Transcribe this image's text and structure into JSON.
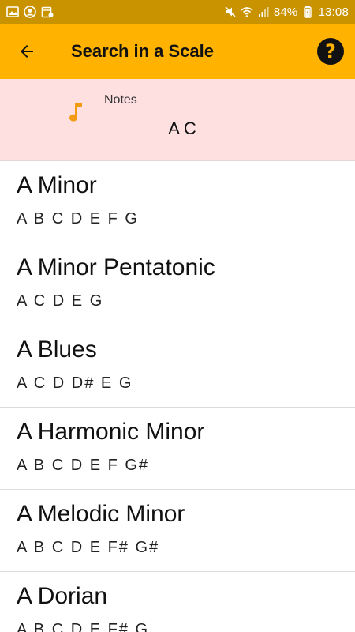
{
  "status_bar": {
    "battery": "84%",
    "time": "13:08",
    "icons": [
      "image-icon",
      "account-icon",
      "calendar-icon",
      "mute-icon",
      "wifi-icon",
      "signal-icon",
      "battery-icon"
    ]
  },
  "app_bar": {
    "title": "Search in a Scale",
    "back_icon": "arrow-left-icon",
    "help_icon": "help-circle-icon",
    "help_glyph": "?"
  },
  "notes": {
    "label": "Notes",
    "value": "A C",
    "icon": "music-note-icon"
  },
  "scales": [
    {
      "name": "A Minor",
      "notes": "A B C D E F G"
    },
    {
      "name": "A Minor Pentatonic",
      "notes": "A C D E G"
    },
    {
      "name": "A Blues",
      "notes": "A C D D# E G"
    },
    {
      "name": "A Harmonic Minor",
      "notes": "A B C D E F G#"
    },
    {
      "name": "A Melodic Minor",
      "notes": "A B C D E F# G#"
    },
    {
      "name": "A Dorian",
      "notes": "A B C D E F# G"
    }
  ],
  "colors": {
    "status_bar": "#c99300",
    "app_bar": "#ffb300",
    "notes_panel": "#ffe0e0",
    "note_icon": "#f39c12"
  }
}
